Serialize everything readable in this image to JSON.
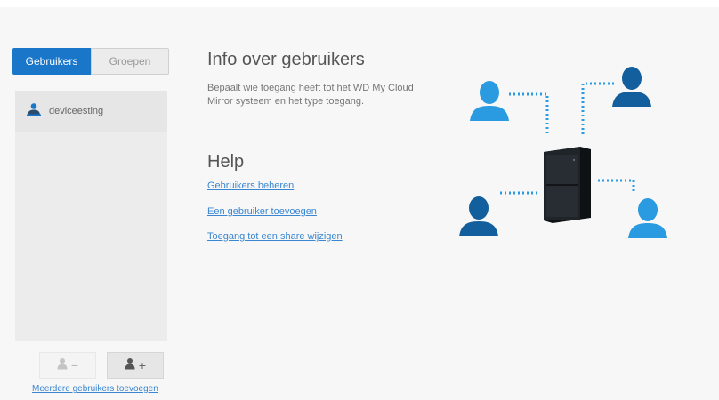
{
  "tabs": {
    "users": "Gebruikers",
    "groups": "Groepen"
  },
  "users": [
    {
      "name": "deviceesting"
    }
  ],
  "buttons": {
    "remove_symbol": "−",
    "add_symbol": "+"
  },
  "footer_link": "Meerdere gebruikers toevoegen",
  "main": {
    "title": "Info over gebruikers",
    "description": "Bepaalt wie toegang heeft tot het WD My Cloud Mirror systeem en het type toegang.",
    "help_title": "Help",
    "help_links": [
      "Gebruikers beheren",
      "Een gebruiker toevoegen",
      "Toegang tot een share wijzigen"
    ]
  },
  "colors": {
    "accent": "#1a76c9",
    "link": "#3a86d1",
    "person_light": "#2a9be0",
    "person_dark": "#135e9c",
    "device": "#1c2024"
  }
}
